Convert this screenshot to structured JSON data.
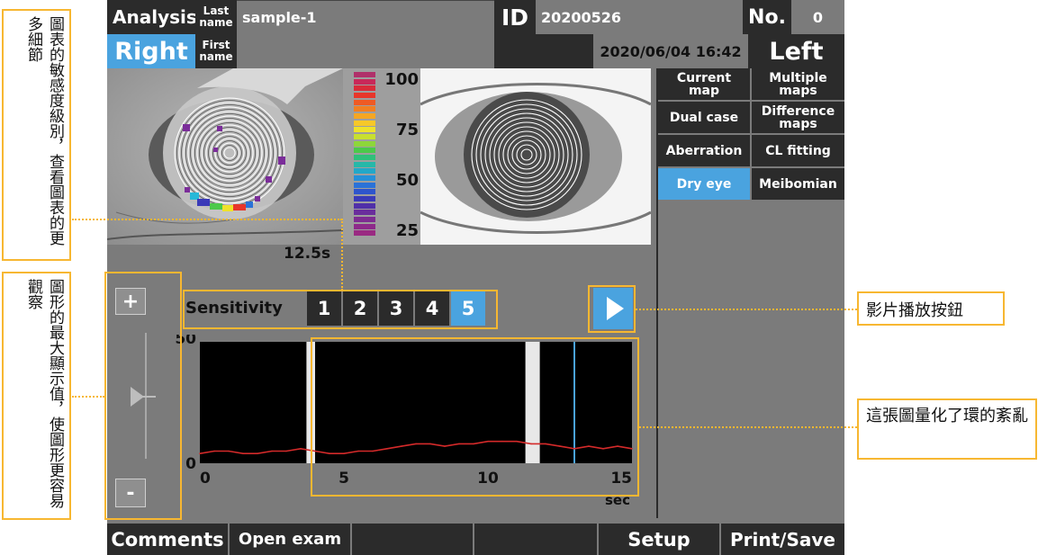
{
  "header": {
    "analysis_label": "Analysis",
    "last_name_label": "Last\nname",
    "last_name_value": "sample-1",
    "id_label": "ID",
    "id_value": "20200526",
    "no_label": "No.",
    "no_value": "0",
    "right_label": "Right",
    "first_name_label": "First\nname",
    "first_name_value": "",
    "datetime": "2020/06/04 16:42",
    "left_label": "Left"
  },
  "menu": [
    {
      "label": "Current\nmap",
      "active": false
    },
    {
      "label": "Multiple\nmaps",
      "active": false
    },
    {
      "label": "Dual case",
      "active": false
    },
    {
      "label": "Difference\nmaps",
      "active": false
    },
    {
      "label": "Aberration",
      "active": false
    },
    {
      "label": "CL fitting",
      "active": false
    },
    {
      "label": "Dry eye",
      "active": true
    },
    {
      "label": "Meibomian",
      "active": false
    }
  ],
  "colorbar": {
    "labels": [
      "100",
      "75",
      "50",
      "25"
    ],
    "colors": [
      "#b0306a",
      "#c8285a",
      "#d92b3a",
      "#e8362a",
      "#ef5a24",
      "#f27f22",
      "#f5a623",
      "#f7c828",
      "#efe22a",
      "#c8e02f",
      "#8ed63a",
      "#4cc94a",
      "#2fc07a",
      "#26b8a8",
      "#22a8c8",
      "#2690d8",
      "#2a72d8",
      "#2e55cc",
      "#3a3ab8",
      "#5030a8",
      "#6a2e9c",
      "#7e2c92",
      "#8e2a8a",
      "#9a2a82"
    ]
  },
  "left_eye_time": "12.5s",
  "sensitivity": {
    "label": "Sensitivity",
    "levels": [
      "1",
      "2",
      "3",
      "4",
      "5"
    ],
    "selected": "5"
  },
  "zoom": {
    "plus": "+",
    "minus": "-"
  },
  "chart_data": {
    "type": "line",
    "x_ticks": [
      "0",
      "5",
      "10",
      "15"
    ],
    "y_ticks": [
      "50",
      "0"
    ],
    "xlabel": "sec",
    "ylim": [
      0,
      50
    ],
    "xlim": [
      0,
      15
    ],
    "series_color": "#d42a2a",
    "cursor_color": "#4aa3df",
    "cursor_x": 13,
    "blink_intervals": [
      [
        3.7,
        4.0
      ],
      [
        11.3,
        11.8
      ]
    ],
    "x": [
      0,
      0.5,
      1,
      1.5,
      2,
      2.5,
      3,
      3.5,
      4,
      4.5,
      5,
      5.5,
      6,
      6.5,
      7,
      7.5,
      8,
      8.5,
      9,
      9.5,
      10,
      10.5,
      11,
      11.5,
      12,
      12.5,
      13,
      13.5,
      14,
      14.5,
      15
    ],
    "values": [
      4,
      5,
      5,
      4,
      4,
      5,
      5,
      6,
      5,
      4,
      4,
      5,
      5,
      6,
      7,
      8,
      8,
      7,
      8,
      8,
      9,
      9,
      9,
      8,
      8,
      7,
      6,
      7,
      6,
      7,
      6
    ]
  },
  "bottom_bar": [
    "Comments",
    "Open exam",
    "",
    "",
    "Setup",
    "Print/Save"
  ],
  "callouts": {
    "left_top": "圖表的敏感度級別，查看圖表的更多細節",
    "left_bottom": "圖形的最大顯示值，使圖形更容易觀察",
    "right_play": "影片播放按鈕",
    "right_chart": "這張圖量化了環的紊亂"
  },
  "colors": {
    "accent": "#4aa3df",
    "callout_border": "#f7b731",
    "panel_dark": "#2b2b2b",
    "panel_gray": "#7b7b7b"
  }
}
